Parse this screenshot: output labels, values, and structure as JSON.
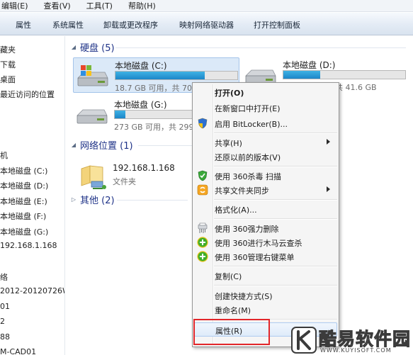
{
  "menubar": {
    "items": [
      "编辑(E)",
      "查看(V)",
      "工具(T)",
      "帮助(H)"
    ]
  },
  "toolbar": {
    "items": [
      "属性",
      "系统属性",
      "卸载或更改程序",
      "映射网络驱动器",
      "打开控制面板"
    ]
  },
  "nav": {
    "items": [
      "藏夹",
      "下载",
      "桌面",
      "最近访问的位置",
      "机",
      "本地磁盘 (C:)",
      "本地磁盘 (D:)",
      "本地磁盘 (E:)",
      "本地磁盘 (F:)",
      "本地磁盘 (G:)",
      "192.168.1.168",
      "络",
      "2012-20120726WK",
      "01",
      "2",
      "88",
      "M-CAD01"
    ]
  },
  "drives_group": {
    "title": "硬盘 (5)",
    "items": [
      {
        "name": "本地磁盘 (C:)",
        "free": "18.7 GB 可用，共 70.",
        "usage": 0.73
      },
      {
        "name": "本地磁盘 (D:)",
        "free": "共 41.6 GB",
        "usage": 0.3
      },
      {
        "name": "本地磁盘 (G:)",
        "free": "273 GB 可用，共 299",
        "usage": 0.09
      }
    ]
  },
  "network_group": {
    "title": "网络位置 (1)",
    "item": {
      "name": "192.168.1.168",
      "type": "文件夹"
    }
  },
  "other_group": {
    "title": "其他 (2)"
  },
  "context_menu": {
    "items": [
      {
        "label": "打开(O)",
        "bold": true
      },
      {
        "label": "在新窗口中打开(E)"
      },
      {
        "label": "启用 BitLocker(B)...",
        "icon": "shield-icon"
      },
      {
        "label": "共享(H)",
        "submenu": true
      },
      {
        "label": "还原以前的版本(V)"
      },
      {
        "label": "使用 360杀毒 扫描",
        "icon": "antivirus-360-icon"
      },
      {
        "label": "共享文件夹同步",
        "icon": "sync-icon",
        "submenu": true
      },
      {
        "label": "格式化(A)..."
      },
      {
        "label": "使用 360强力删除",
        "icon": "shredder-icon"
      },
      {
        "label": "使用 360进行木马云查杀",
        "icon": "360-plus-icon"
      },
      {
        "label": "使用 360管理右键菜单",
        "icon": "360-plus-icon"
      },
      {
        "label": "复制(C)"
      },
      {
        "label": "创建快捷方式(S)"
      },
      {
        "label": "重命名(M)"
      },
      {
        "label": "属性(R)"
      }
    ]
  },
  "watermark": {
    "text": "酷易软件园",
    "url": "WWW.KUYISOFT.COM"
  },
  "colors": {
    "group_header": "#1e3287",
    "selection": "#dbe9f8",
    "highlight_box": "#e2262a"
  }
}
